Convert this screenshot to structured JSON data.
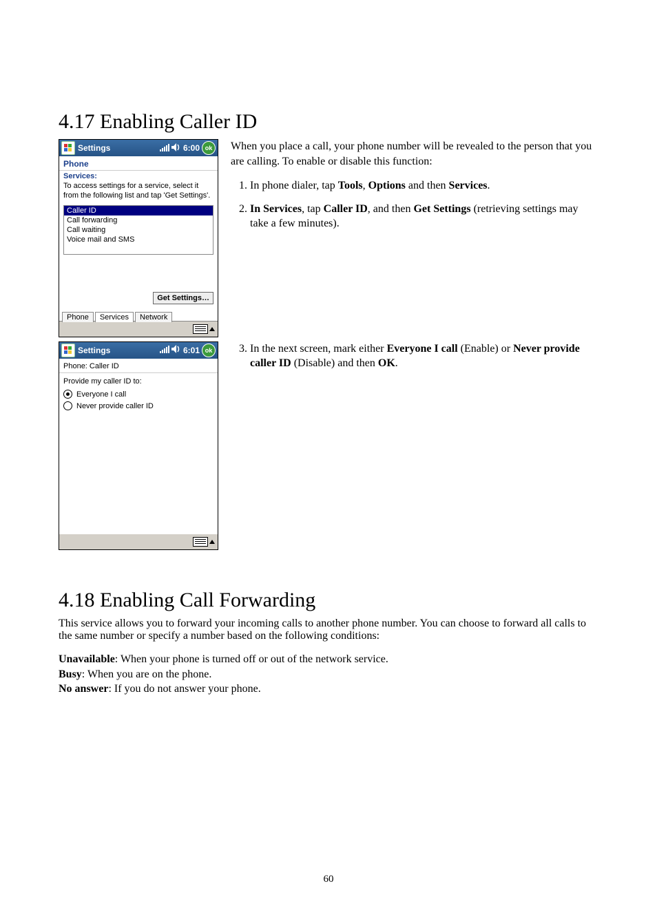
{
  "section417": {
    "heading": "4.17  Enabling Caller ID"
  },
  "section418": {
    "heading": "4.18  Enabling Call Forwarding"
  },
  "shot1": {
    "titlebar": {
      "text": "Settings",
      "time": "6:00",
      "ok": "ok"
    },
    "subtitle": "Phone",
    "services_label": "Services:",
    "services_desc": "To access settings for a service, select it from the following list and tap 'Get Settings'.",
    "items": [
      "Caller ID",
      "Call forwarding",
      "Call waiting",
      "Voice mail and SMS"
    ],
    "get_button": "Get Settings…",
    "tabs": [
      "Phone",
      "Services",
      "Network"
    ]
  },
  "shot2": {
    "titlebar": {
      "text": "Settings",
      "time": "6:01",
      "ok": "ok"
    },
    "subtitle": "Phone: Caller ID",
    "provide_label": "Provide my caller ID to:",
    "opt1": "Everyone I call",
    "opt2": "Never provide caller ID"
  },
  "text417": {
    "intro": "When you place a call, your phone number will be revealed to the person that you are calling. To enable or disable this function:",
    "step1_pre": "In phone dialer, tap ",
    "step1_b1": "Tools",
    "step1_mid1": ", ",
    "step1_b2": "Options",
    "step1_mid2": " and then ",
    "step1_b3": "Services",
    "step1_post": ".",
    "step2_b1": "In Services",
    "step2_mid1": ", tap ",
    "step2_b2": "Caller ID",
    "step2_mid2": ", and then ",
    "step2_b3": "Get Settings",
    "step2_post": " (retrieving settings may take a few minutes).",
    "step3_pre": "In the next screen, mark either ",
    "step3_b1": "Everyone I call",
    "step3_mid1": " (Enable) or ",
    "step3_b2": "Never provide caller ID",
    "step3_mid2": " (Disable) and then ",
    "step3_b3": "OK",
    "step3_post": "."
  },
  "text418": {
    "intro": "This service allows you to forward your incoming calls to another phone number. You can choose to forward all calls to the same number or specify a number based on the following conditions:",
    "c1b": "Unavailable",
    "c1t": ": When your phone is turned off or out of the network service.",
    "c2b": "Busy",
    "c2t": ": When you are on the phone.",
    "c3b": "No answer",
    "c3t": ": If you do not answer your phone."
  },
  "pagenum": "60"
}
